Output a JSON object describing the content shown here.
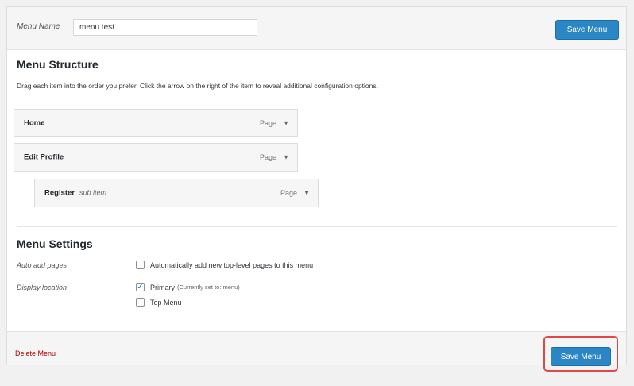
{
  "header": {
    "menu_name_label": "Menu Name",
    "menu_name_value": "menu test",
    "save_label": "Save Menu"
  },
  "structure": {
    "title": "Menu Structure",
    "instructions": "Drag each item into the order you prefer. Click the arrow on the right of the item to reveal additional configuration options.",
    "items": [
      {
        "title": "Home",
        "subtitle": "",
        "type": "Page",
        "arrow": "▼"
      },
      {
        "title": "Edit Profile",
        "subtitle": "",
        "type": "Page",
        "arrow": "▼"
      },
      {
        "title": "Register",
        "subtitle": "sub item",
        "type": "Page",
        "arrow": "▼"
      }
    ]
  },
  "settings": {
    "title": "Menu Settings",
    "auto_add_label": "Auto add pages",
    "auto_add_option": "Automatically add new top-level pages to this menu",
    "display_location_label": "Display location",
    "locations": [
      {
        "label": "Primary",
        "hint": "(Currently set to: menu)",
        "checked": true,
        "checkmark": "✓"
      },
      {
        "label": "Top Menu",
        "hint": "",
        "checked": false,
        "checkmark": ""
      }
    ]
  },
  "footer": {
    "delete_label": "Delete Menu",
    "save_label": "Save Menu"
  },
  "colors": {
    "primary_button": "#2a86c4",
    "delete_link": "#aa0000",
    "highlight": "#e04848"
  }
}
